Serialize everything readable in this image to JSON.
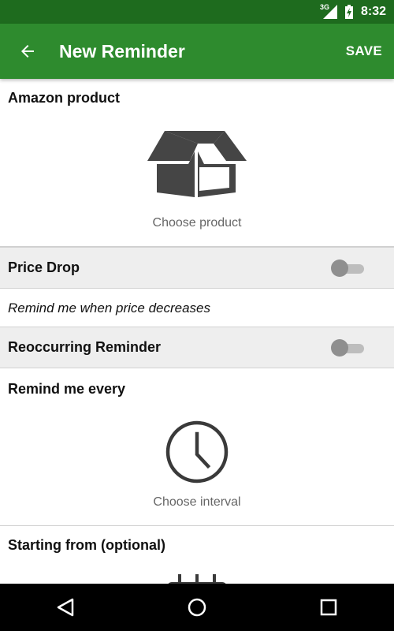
{
  "status_bar": {
    "network": "3G",
    "time": "8:32",
    "icons": [
      "signal-icon",
      "battery-charging-icon"
    ]
  },
  "app_bar": {
    "back_icon": "arrow-back-icon",
    "title": "New Reminder",
    "save_label": "SAVE",
    "color": "#2e8b2e"
  },
  "amazon_product": {
    "title": "Amazon product",
    "icon": "open-box-icon",
    "picker_label": "Choose product"
  },
  "price_drop": {
    "label": "Price Drop",
    "enabled": false,
    "description": "Remind me when price decreases"
  },
  "reoccurring": {
    "label": "Reoccurring Reminder",
    "enabled": false
  },
  "remind_every": {
    "title": "Remind me every",
    "icon": "clock-icon",
    "picker_label": "Choose interval"
  },
  "starting_from": {
    "title": "Starting from (optional)",
    "icon": "calendar-icon"
  },
  "nav_bar": {
    "icons": [
      "nav-back-icon",
      "nav-home-icon",
      "nav-recents-icon"
    ]
  }
}
